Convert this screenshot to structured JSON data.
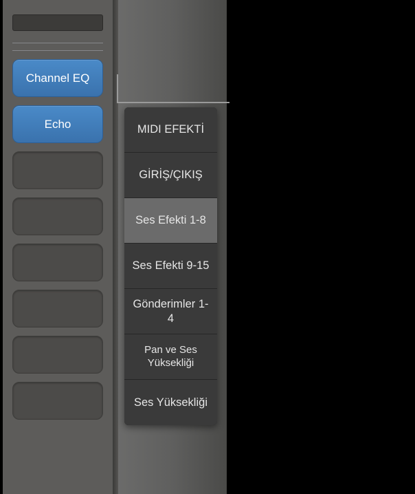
{
  "channel_strip": {
    "slots": [
      {
        "label": "Channel EQ",
        "filled": true
      },
      {
        "label": "Echo",
        "filled": true
      },
      {
        "label": "",
        "filled": false
      },
      {
        "label": "",
        "filled": false
      },
      {
        "label": "",
        "filled": false
      },
      {
        "label": "",
        "filled": false
      },
      {
        "label": "",
        "filled": false
      },
      {
        "label": "",
        "filled": false
      }
    ]
  },
  "menu": {
    "items": [
      {
        "label": "MIDI EFEKTİ",
        "selected": false,
        "small": false
      },
      {
        "label": "GİRİŞ/ÇIKIŞ",
        "selected": false,
        "small": false
      },
      {
        "label": "Ses Efekti 1-8",
        "selected": true,
        "small": false
      },
      {
        "label": "Ses Efekti 9-15",
        "selected": false,
        "small": false
      },
      {
        "label": "Gönderimler 1-4",
        "selected": false,
        "small": false
      },
      {
        "label": "Pan ve Ses Yüksekliği",
        "selected": false,
        "small": true
      },
      {
        "label": "Ses Yüksekliği",
        "selected": false,
        "small": false
      }
    ]
  }
}
